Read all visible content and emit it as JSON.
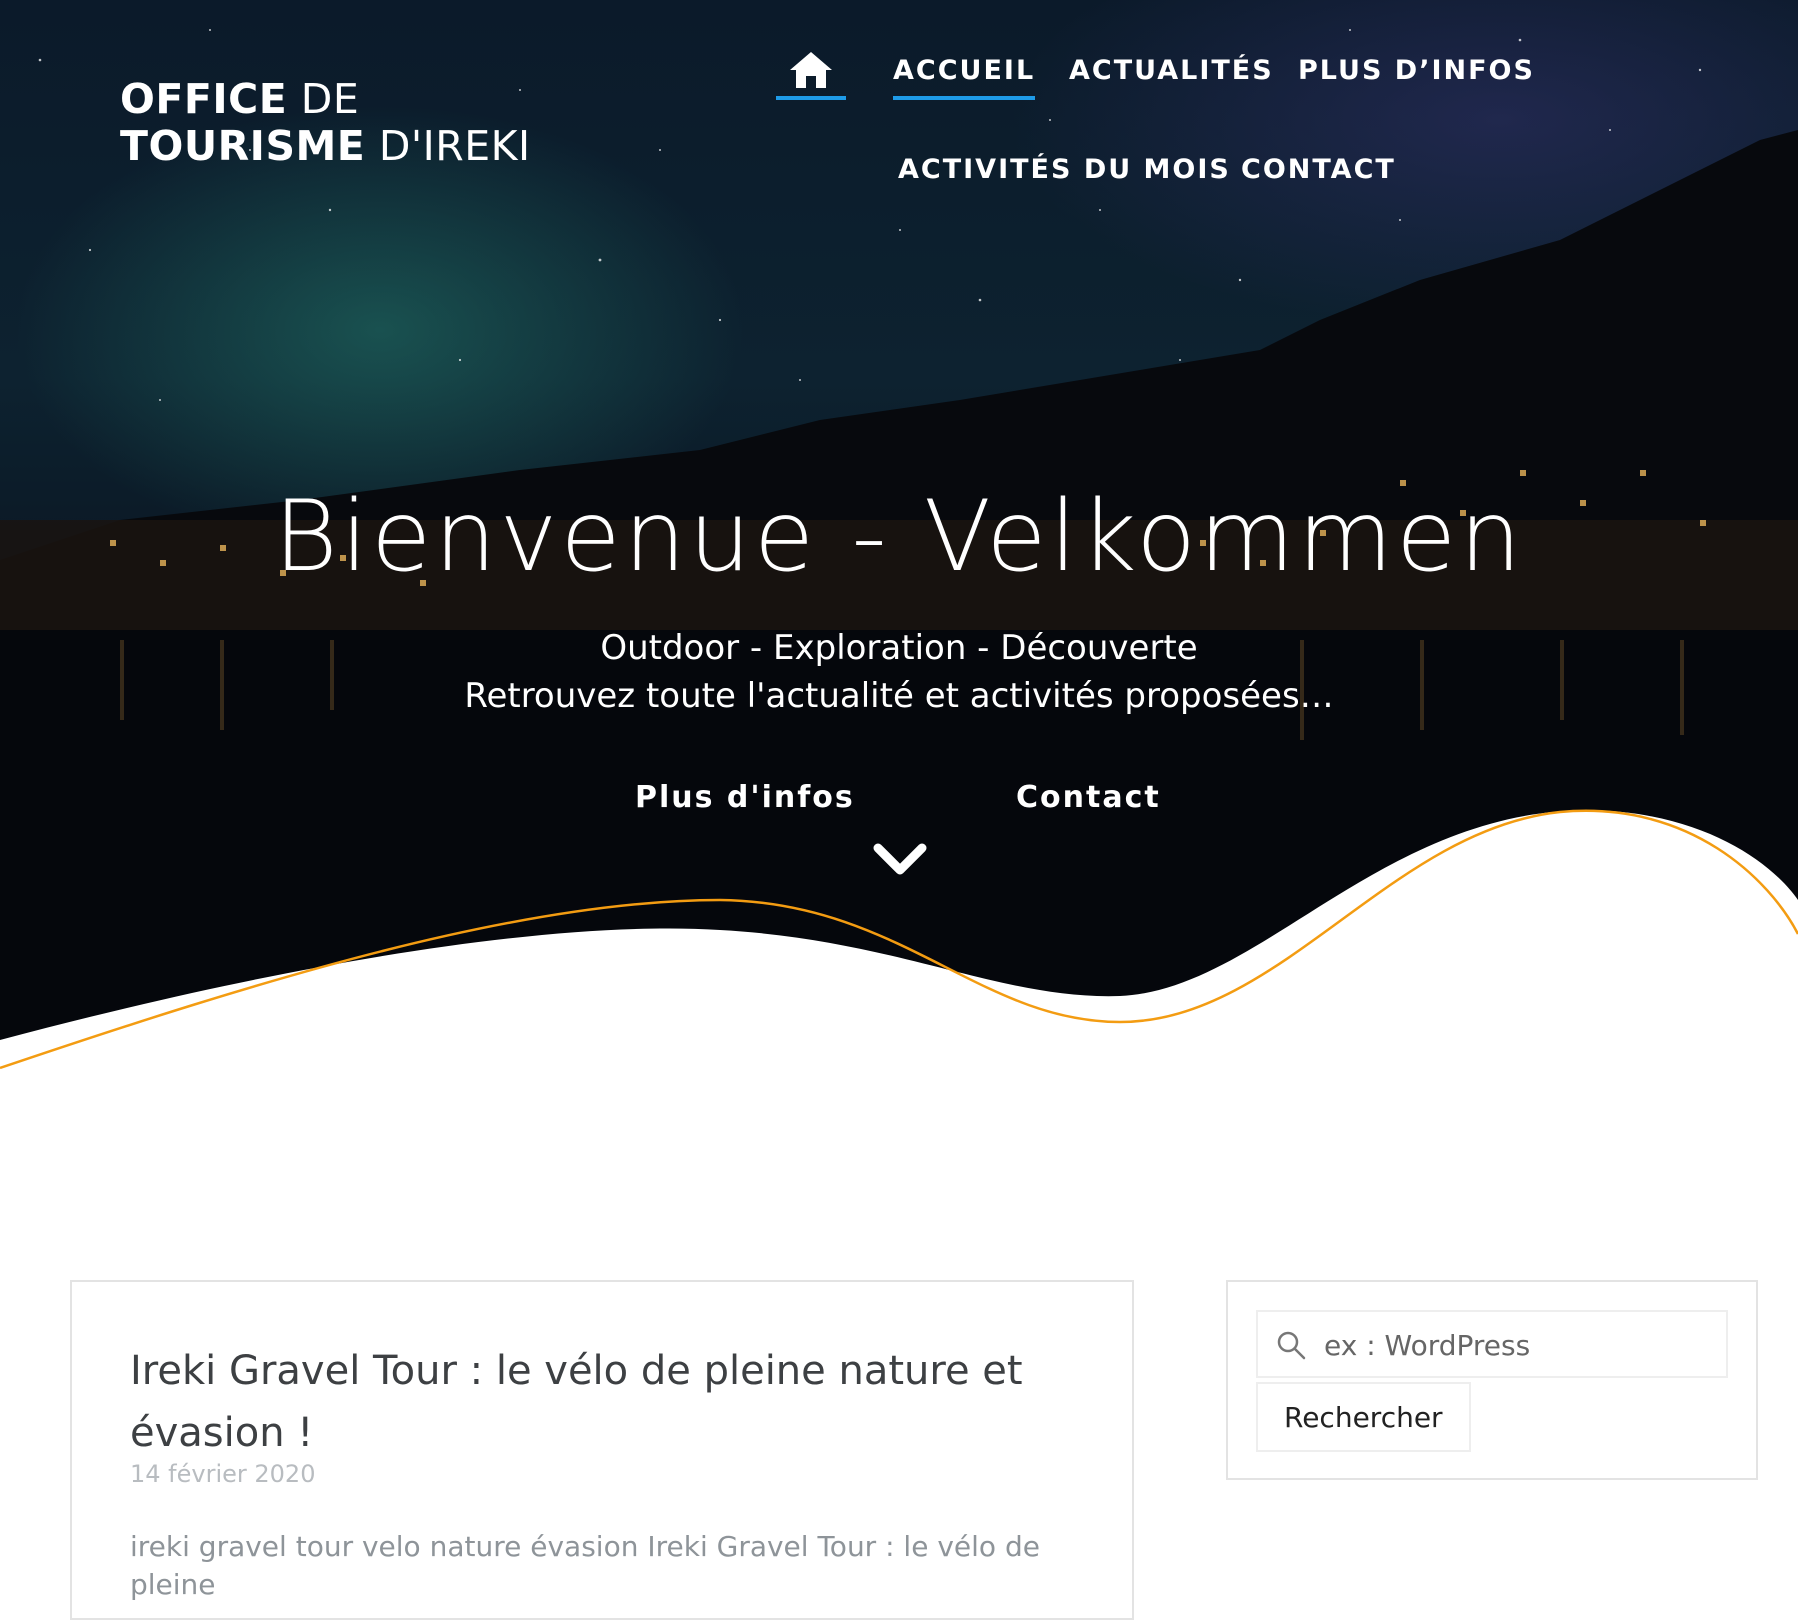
{
  "logo": {
    "line1_bold": "OFFICE",
    "line1_thin": "DE",
    "line2_bold": "TOURISME",
    "line2_thin": "D'IREKI"
  },
  "nav": {
    "home_icon": "home-icon",
    "items": [
      {
        "label": "ACCUEIL",
        "active": true
      },
      {
        "label": "ACTUALITÉS",
        "active": false
      },
      {
        "label": "PLUS D’INFOS",
        "active": false
      },
      {
        "label": "ACTIVITÉS DU MOIS",
        "active": false
      },
      {
        "label": "CONTACT",
        "active": false
      }
    ]
  },
  "hero": {
    "title": "Bienvenue - Velkommen",
    "subtitle_line1": "Outdoor - Exploration - Découverte",
    "subtitle_line2": "Retrouvez toute l'actualité et activités proposées…",
    "buttons": [
      "Plus d'infos",
      "Contact"
    ],
    "scroll_icon": "chevron-down-icon"
  },
  "post": {
    "title": "Ireki Gravel Tour : le vélo de pleine nature et évasion !",
    "date": "14 février 2020",
    "excerpt": "ireki gravel tour velo nature évasion Ireki Gravel Tour : le vélo de pleine"
  },
  "search": {
    "placeholder": "ex : WordPress",
    "button_label": "Rechercher",
    "icon": "search-icon"
  },
  "colors": {
    "accent": "#1e9be8",
    "wave_line": "#f39c12",
    "hero_dark": "#0b1a2a"
  }
}
